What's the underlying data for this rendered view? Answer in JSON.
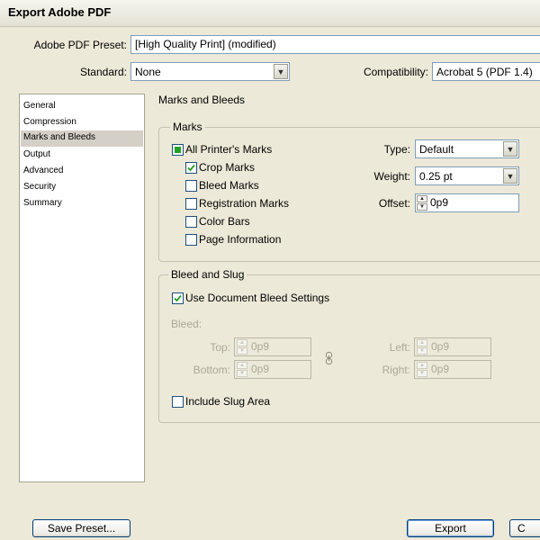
{
  "window": {
    "title": "Export Adobe PDF"
  },
  "preset": {
    "label": "Adobe PDF Preset:",
    "value": "[High Quality Print] (modified)"
  },
  "standard": {
    "label": "Standard:",
    "value": "None"
  },
  "compatibility": {
    "label": "Compatibility:",
    "value": "Acrobat 5 (PDF 1.4)"
  },
  "sidebar": {
    "items": [
      {
        "label": "General"
      },
      {
        "label": "Compression"
      },
      {
        "label": "Marks and Bleeds",
        "selected": true
      },
      {
        "label": "Output"
      },
      {
        "label": "Advanced"
      },
      {
        "label": "Security"
      },
      {
        "label": "Summary"
      }
    ]
  },
  "panel": {
    "heading": "Marks and Bleeds"
  },
  "marks": {
    "group_title": "Marks",
    "all_printers_marks": {
      "label": "All Printer's Marks",
      "state": "mixed"
    },
    "crop_marks": {
      "label": "Crop Marks",
      "checked": true
    },
    "bleed_marks": {
      "label": "Bleed Marks",
      "checked": false
    },
    "registration_marks": {
      "label": "Registration Marks",
      "checked": false
    },
    "color_bars": {
      "label": "Color Bars",
      "checked": false
    },
    "page_information": {
      "label": "Page Information",
      "checked": false
    },
    "type": {
      "label": "Type:",
      "value": "Default"
    },
    "weight": {
      "label": "Weight:",
      "value": "0.25 pt"
    },
    "offset": {
      "label": "Offset:",
      "value": "0p9"
    }
  },
  "bleed_slug": {
    "group_title": "Bleed and Slug",
    "use_document_bleed": {
      "label": "Use Document Bleed Settings",
      "checked": true
    },
    "bleed_label": "Bleed:",
    "top": {
      "label": "Top:",
      "value": "0p9"
    },
    "bottom": {
      "label": "Bottom:",
      "value": "0p9"
    },
    "left": {
      "label": "Left:",
      "value": "0p9"
    },
    "right": {
      "label": "Right:",
      "value": "0p9"
    },
    "include_slug": {
      "label": "Include Slug Area",
      "checked": false
    }
  },
  "buttons": {
    "save_preset": "Save Preset...",
    "export": "Export",
    "cancel": "C"
  },
  "colors": {
    "background": "#ece9d8",
    "field_border": "#7f9db9",
    "checkmark": "#21a121",
    "selected_item": "#d4d0c8"
  }
}
